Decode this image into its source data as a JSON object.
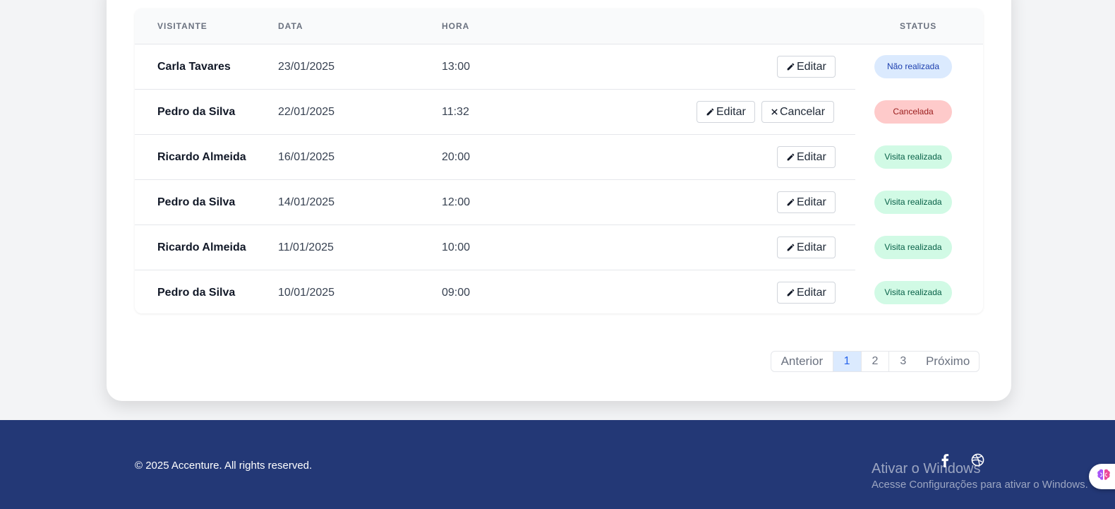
{
  "table": {
    "headers": {
      "visitor": "VISITANTE",
      "date": "DATA",
      "time": "HORA",
      "status": "STATUS"
    },
    "rows": [
      {
        "visitor": "Carla Tavares",
        "date": "23/01/2025",
        "time": "13:00",
        "actions": [
          "Editar"
        ],
        "status": "Não realizada",
        "status_kind": "pending"
      },
      {
        "visitor": "Pedro da Silva",
        "date": "22/01/2025",
        "time": "11:32",
        "actions": [
          "Editar",
          "Cancelar"
        ],
        "status": "Cancelada",
        "status_kind": "cancelled"
      },
      {
        "visitor": "Ricardo Almeida",
        "date": "16/01/2025",
        "time": "20:00",
        "actions": [
          "Editar"
        ],
        "status": "Visita realizada",
        "status_kind": "done"
      },
      {
        "visitor": "Pedro da Silva",
        "date": "14/01/2025",
        "time": "12:00",
        "actions": [
          "Editar"
        ],
        "status": "Visita realizada",
        "status_kind": "done"
      },
      {
        "visitor": "Ricardo Almeida",
        "date": "11/01/2025",
        "time": "10:00",
        "actions": [
          "Editar"
        ],
        "status": "Visita realizada",
        "status_kind": "done"
      },
      {
        "visitor": "Pedro da Silva",
        "date": "10/01/2025",
        "time": "09:00",
        "actions": [
          "Editar"
        ],
        "status": "Visita realizada",
        "status_kind": "done"
      }
    ],
    "edit_icon": "pencil-icon",
    "cancel_icon": "close-icon"
  },
  "pagination": {
    "prev_label": "Anterior",
    "pages": [
      "1",
      "2",
      "3"
    ],
    "current_page": "1",
    "next_label": "Próximo"
  },
  "footer": {
    "copyright": "© 2025 Accenture. All rights reserved.",
    "social_icons": [
      "facebook-icon",
      "dribbble-icon"
    ]
  },
  "os_watermark": {
    "title": "Ativar o Windows",
    "subtitle": "Acesse Configurações para ativar o Windows."
  },
  "colors": {
    "footer_bg": "#233876",
    "badge_pending": "#dbeafe",
    "badge_cancelled": "#fecaca",
    "badge_done": "#d1fae5"
  }
}
